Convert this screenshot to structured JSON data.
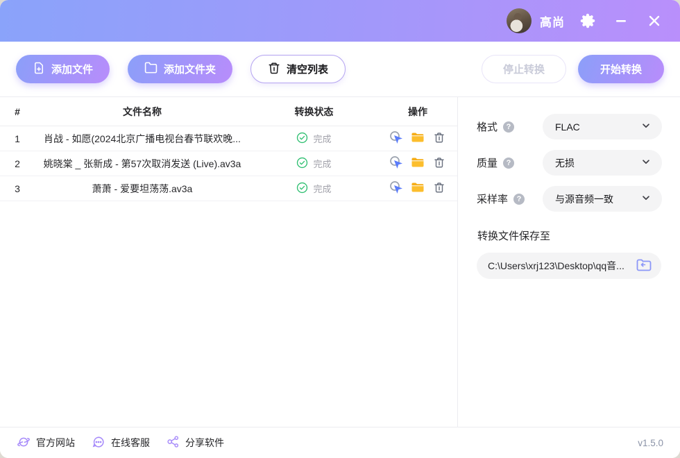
{
  "titlebar": {
    "username": "高尚"
  },
  "toolbar": {
    "add_file": "添加文件",
    "add_folder": "添加文件夹",
    "clear_list": "清空列表",
    "stop": "停止转换",
    "start": "开始转换"
  },
  "table": {
    "headers": {
      "index": "#",
      "filename": "文件名称",
      "status": "转换状态",
      "actions": "操作"
    },
    "rows": [
      {
        "index": "1",
        "filename": "肖战 - 如愿(2024北京广播电视台春节联欢晚...",
        "status": "完成"
      },
      {
        "index": "2",
        "filename": "姚晓棠 _ 张新成 - 第57次取消发送 (Live).av3a",
        "status": "完成"
      },
      {
        "index": "3",
        "filename": "萧萧 - 爱要坦荡荡.av3a",
        "status": "完成"
      }
    ]
  },
  "settings": {
    "format_label": "格式",
    "format_value": "FLAC",
    "quality_label": "质量",
    "quality_value": "无损",
    "samplerate_label": "采样率",
    "samplerate_value": "与源音频一致",
    "save_label": "转换文件保存至",
    "save_path": "C:\\Users\\xrj123\\Desktop\\qq音..."
  },
  "footer": {
    "website": "官方网站",
    "support": "在线客服",
    "share": "分享软件",
    "version": "v1.5.0"
  },
  "icons": {
    "titlebar": [
      "gear",
      "minimize",
      "close"
    ],
    "row_actions": [
      "locate-cursor",
      "open-folder",
      "delete-trash"
    ],
    "status": "check-circle",
    "footer": [
      "planet",
      "chat",
      "share-nodes"
    ]
  },
  "colors": {
    "titlebar_gradient": [
      "#8aa3fa",
      "#b98ffb"
    ],
    "button_gradient": [
      "#8b9ff9",
      "#b88dfb"
    ],
    "accent_purple": "#a78bfa",
    "status_green": "#2fbf71",
    "folder_amber": "#fbbf24",
    "cursor_blue": "#5b7cfa"
  }
}
